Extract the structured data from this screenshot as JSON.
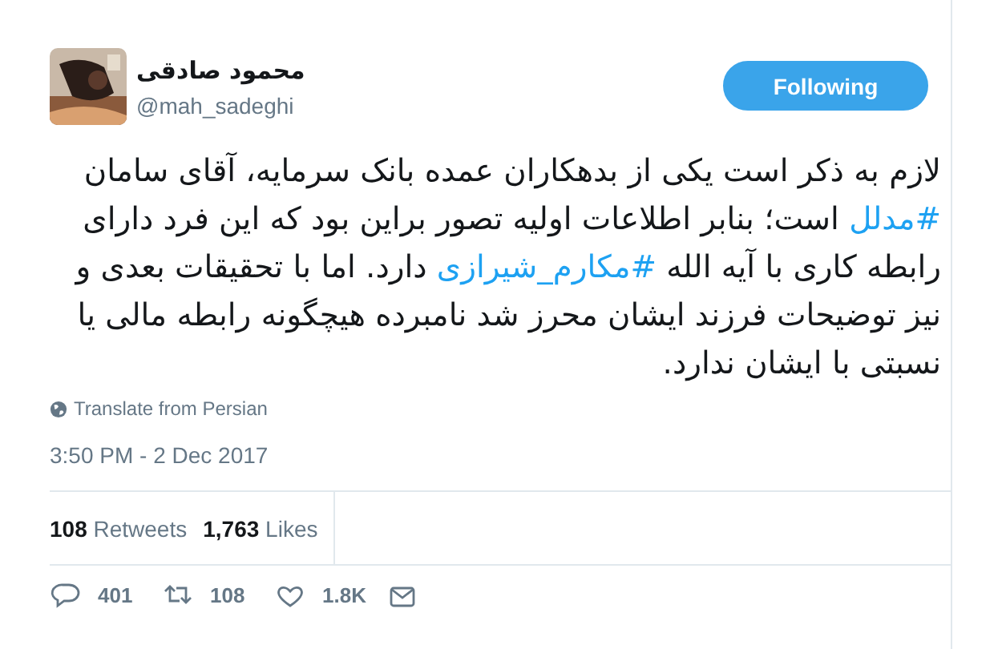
{
  "author": {
    "name": "محمود صادقی",
    "handle": "@mah_sadeghi"
  },
  "follow_button": {
    "label": "Following",
    "selected": true
  },
  "tweet_text": [
    {
      "kind": "text",
      "text": "لازم به ذکر است یکی از بدهکاران عمده بانک سرمایه، آقای سامان "
    },
    {
      "kind": "hashtag",
      "text": "#مدلل"
    },
    {
      "kind": "text",
      "text": " است؛ بنابر اطلاعات اولیه تصور براین بود که این فرد دارای رابطه کاری با آیه الله "
    },
    {
      "kind": "hashtag",
      "text": "#مکارم_شیرازی"
    },
    {
      "kind": "text",
      "text": " دارد. اما با تحقیقات بعدی و نیز توضیحات فرزند ایشان محرز شد نامبرده هیچگونه رابطه مالی یا نسبتی با ایشان ندارد."
    }
  ],
  "translate_link": "Translate from Persian",
  "timestamp": "3:50 PM - 2 Dec 2017",
  "retweet_stat": {
    "count": "108",
    "label": "Retweets"
  },
  "like_stat": {
    "count": "1,763",
    "label": "Likes"
  },
  "reply_action": {
    "count": "401"
  },
  "retweet_action": {
    "count": "108"
  },
  "like_action": {
    "count": "1.8K"
  }
}
